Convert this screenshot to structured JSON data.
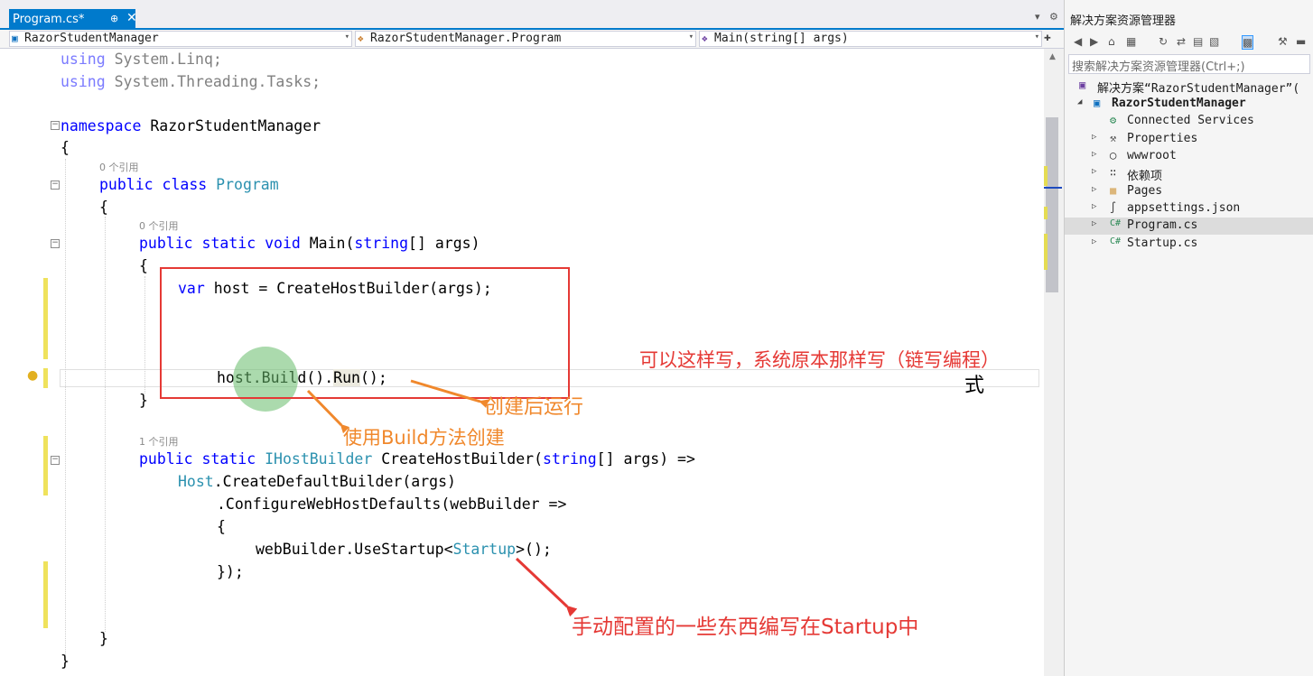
{
  "tab": {
    "label": "Program.cs*",
    "pin": "⊕",
    "close": "✕"
  },
  "tabbar_controls": {
    "dropdown": "▾",
    "settings": "⚙"
  },
  "navbar": {
    "project": "RazorStudentManager",
    "class": "RazorStudentManager.Program",
    "member": "Main(string[] args)",
    "split": "✚"
  },
  "code": {
    "l1_kw": "using",
    "l1_rest": " System.Linq;",
    "l2_kw": "using",
    "l2_rest": " System.Threading.Tasks;",
    "l3_kw": "namespace",
    "l3_rest": " RazorStudentManager",
    "open": "{",
    "close": "}",
    "ref0a": "0 个引用",
    "class_kw": "public class ",
    "class_name": "Program",
    "ref0b": "0 个引用",
    "main_kw": "public static void ",
    "main_name": "Main(",
    "main_str": "string",
    "main_rest": "[] args)",
    "var_kw": "var",
    "var_rest": " host = CreateHostBuilder(args);",
    "run_a": "host.",
    "run_b": "Build",
    "run_c": "().",
    "run_d": "Run",
    "run_e": "();",
    "ref1": "1 个引用",
    "chb_kw": "public static ",
    "chb_type": "IHostBuilder",
    "chb_mid": " CreateHostBuilder(",
    "chb_str": "string",
    "chb_rest": "[] args) =>",
    "host_type": "Host",
    "host_rest": ".CreateDefaultBuilder(args)",
    "cfg": ".ConfigureWebHostDefaults(webBuilder =>",
    "use_a": "webBuilder.UseStartup<",
    "use_type": "Startup",
    "use_b": ">();",
    "end_lambda": "});"
  },
  "annotations": {
    "red_note": "可以这样写，系统原本那样写（链写编程）",
    "black_note": "式",
    "run_note": "创建后运行",
    "build_note": "使用Build方法创建",
    "startup_note": "手动配置的一些东西编写在Startup中"
  },
  "solution_explorer": {
    "title": "解决方案资源管理器",
    "search_placeholder": "搜索解决方案资源管理器(Ctrl+;)",
    "solution": "解决方案“RazorStudentManager”(",
    "project": "RazorStudentManager",
    "items": [
      {
        "label": "Connected Services",
        "icon": "connected-services-icon"
      },
      {
        "label": "Properties",
        "icon": "wrench-icon"
      },
      {
        "label": "wwwroot",
        "icon": "globe-icon"
      },
      {
        "label": "依赖项",
        "icon": "dependencies-icon"
      },
      {
        "label": "Pages",
        "icon": "folder-icon"
      },
      {
        "label": "appsettings.json",
        "icon": "json-file-icon"
      },
      {
        "label": "Program.cs",
        "icon": "csharp-file-icon"
      },
      {
        "label": "Startup.cs",
        "icon": "csharp-file-icon"
      }
    ]
  },
  "colors": {
    "keyword": "#0000ff",
    "type": "#2b91af",
    "annotation_red": "#e53935",
    "annotation_orange": "#f0882c",
    "tab_active": "#007acc"
  }
}
